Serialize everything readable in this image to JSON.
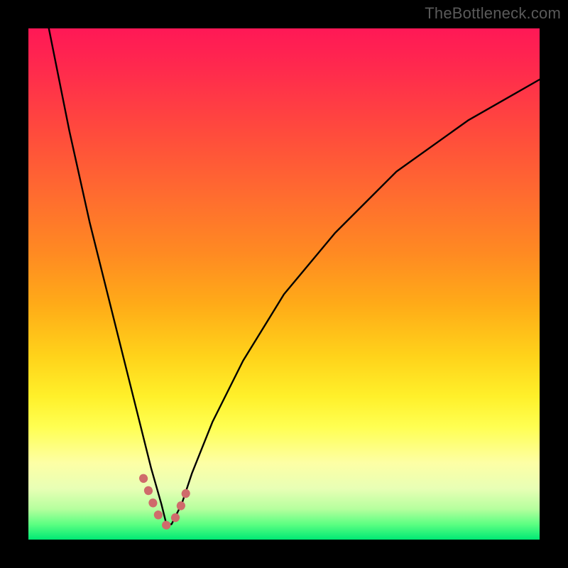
{
  "watermark": "TheBottleneck.com",
  "chart_data": {
    "type": "line",
    "title": "",
    "xlabel": "",
    "ylabel": "",
    "xlim": [
      0,
      100
    ],
    "ylim": [
      0,
      100
    ],
    "grid": false,
    "legend": false,
    "series": [
      {
        "name": "bottleneck-curve",
        "x": [
          4,
          8,
          12,
          16,
          20,
          22,
          24,
          26,
          27,
          28,
          30,
          32,
          36,
          42,
          50,
          60,
          72,
          86,
          100
        ],
        "y": [
          100,
          80,
          62,
          46,
          30,
          22,
          14,
          7,
          3,
          3,
          7,
          13,
          23,
          35,
          48,
          60,
          72,
          82,
          90
        ],
        "stroke": "#000000",
        "stroke_width": 2.4
      },
      {
        "name": "highlight-segment",
        "x": [
          22.5,
          23.5,
          24.5,
          25.5,
          26.5,
          27.0,
          27.5,
          28.0,
          28.5,
          29.5,
          30.5,
          31.5
        ],
        "y": [
          12,
          9.5,
          6.8,
          4.6,
          3.2,
          2.8,
          2.8,
          3.0,
          3.8,
          5.8,
          8.2,
          11.0
        ],
        "stroke": "#cf6b6b",
        "stroke_width": 12,
        "dash": "0.5 18"
      }
    ]
  }
}
